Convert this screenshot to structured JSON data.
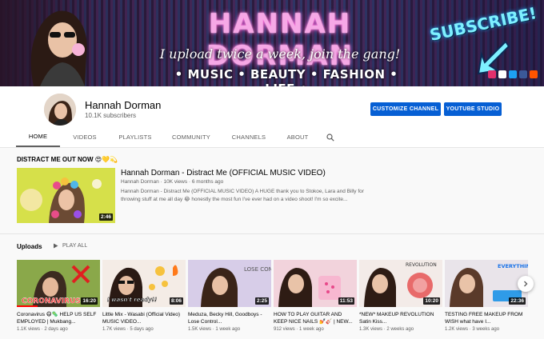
{
  "banner": {
    "title": "HANNAH DORMAN",
    "tagline": "I upload twice a week, join the gang!",
    "categories": "• MUSIC • BEAUTY • FASHION • LIFE •",
    "subscribe": "SUBSCRIBE!"
  },
  "channel": {
    "name": "Hannah Dorman",
    "subscribers": "10.1K subscribers",
    "customize_label": "CUSTOMIZE CHANNEL",
    "studio_label": "YOUTUBE STUDIO"
  },
  "tabs": [
    {
      "label": "HOME"
    },
    {
      "label": "VIDEOS"
    },
    {
      "label": "PLAYLISTS"
    },
    {
      "label": "COMMUNITY"
    },
    {
      "label": "CHANNELS"
    },
    {
      "label": "ABOUT"
    }
  ],
  "featured": {
    "heading": "DISTRACT ME OUT NOW 😍💛💫",
    "title": "Hannah Dorman - Distract Me (OFFICIAL MUSIC VIDEO)",
    "meta": "Hannah Dorman · 10K views · 6 months ago",
    "description": "Hannah Dorman - Distract Me (OFFICIAL MUSIC VIDEO) A HUGE thank you to Stokoe, Lara and Billy for throwing stuff at me all day 😂 honestly the most fun I've ever had on a video shoot! I'm so excite...",
    "duration": "2:46"
  },
  "uploads": {
    "heading": "Uploads",
    "play_all": "PLAY ALL",
    "videos": [
      {
        "title": "Coronavirus 😷🦠 HELP US SELF EMPLOYED | Mukbang...",
        "meta": "1.1K views · 2 days ago",
        "duration": "16:20",
        "overlay": "CORONAVIRUS",
        "progress": 0.25
      },
      {
        "title": "Little Mix - Wasabi (Official Video) MUSIC VIDEO...",
        "meta": "1.7K views · 5 days ago",
        "duration": "8:06",
        "overlay": "I wasn't ready!!",
        "progress": 0.0
      },
      {
        "title": "Meduza, Becky Hill, Goodboys - Lose Control...",
        "meta": "1.5K views · 1 week ago",
        "duration": "2:25",
        "overlay": "LOSE CONTROL",
        "progress": 0.0
      },
      {
        "title": "HOW TO PLAY GUITAR AND KEEP NICE NAILS 💅🎸 | NEW...",
        "meta": "912 views · 1 week ago",
        "duration": "11:53",
        "overlay": "",
        "progress": 0.0
      },
      {
        "title": "*NEW* MAKEUP REVOLUTION Satin Kiss...",
        "meta": "1.3K views · 2 weeks ago",
        "duration": "10:20",
        "overlay": "REVOLUTION",
        "progress": 0.0
      },
      {
        "title": "TESTING FREE MAKEUP FROM WISH what have I...",
        "meta": "1.2K views · 3 weeks ago",
        "duration": "22:36",
        "overlay": "EVERYTHING FREE",
        "progress": 0.0
      }
    ]
  }
}
